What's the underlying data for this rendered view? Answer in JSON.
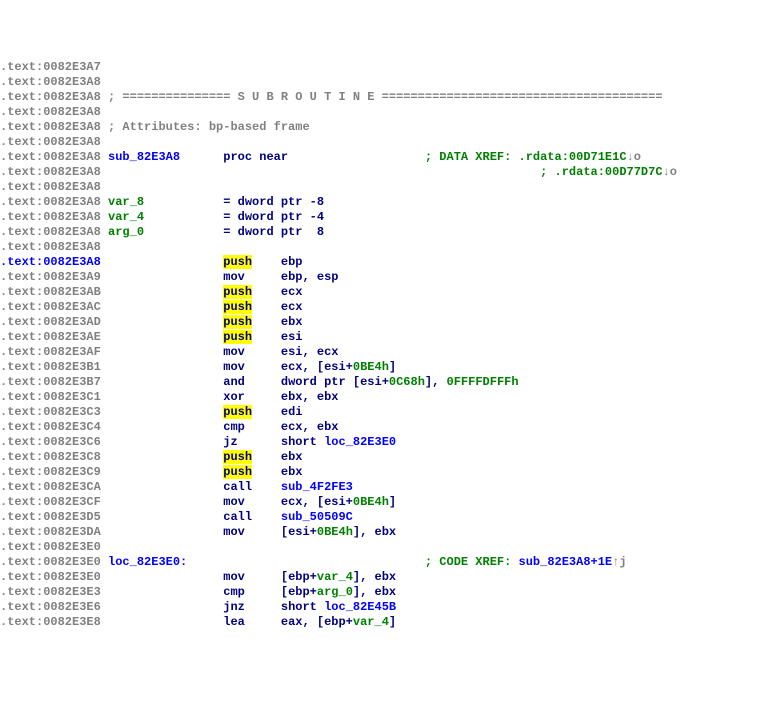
{
  "lines": [
    {
      "addr": ".text:0082E3A7"
    },
    {
      "addr": ".text:0082E3A8"
    },
    {
      "addr": ".text:0082E3A8",
      "cmt_sep": "; =============== S U B R O U T I N E ======================================="
    },
    {
      "addr": ".text:0082E3A8"
    },
    {
      "addr": ".text:0082E3A8",
      "cmt": "; Attributes: bp-based frame"
    },
    {
      "addr": ".text:0082E3A8"
    },
    {
      "addr": ".text:0082E3A8",
      "label": "sub_82E3A8",
      "proc": "proc near",
      "xref_cmt": "; DATA XREF: .rdata:00D71E1C",
      "xref_suffix": "↓o"
    },
    {
      "addr": ".text:0082E3A8",
      "xref_cmt": "; .rdata:00D77D7C",
      "xref_suffix": "↓o"
    },
    {
      "addr": ".text:0082E3A8"
    },
    {
      "addr": ".text:0082E3A8",
      "var": "var_8",
      "vardef": "= dword ptr -8"
    },
    {
      "addr": ".text:0082E3A8",
      "var": "var_4",
      "vardef": "= dword ptr -4"
    },
    {
      "addr": ".text:0082E3A8",
      "var": "arg_0",
      "vardef": "= dword ptr  8"
    },
    {
      "addr": ".text:0082E3A8"
    },
    {
      "addr": ".text:0082E3A8",
      "current": true,
      "hl": true,
      "op": "push",
      "reg": "ebp"
    },
    {
      "addr": ".text:0082E3A9",
      "op": "mov",
      "asm": "ebp, esp"
    },
    {
      "addr": ".text:0082E3AB",
      "hl": true,
      "op": "push",
      "reg": "ecx"
    },
    {
      "addr": ".text:0082E3AC",
      "hl": true,
      "op": "push",
      "reg": "ecx"
    },
    {
      "addr": ".text:0082E3AD",
      "hl": true,
      "op": "push",
      "reg": "ebx"
    },
    {
      "addr": ".text:0082E3AE",
      "hl": true,
      "op": "push",
      "reg": "esi"
    },
    {
      "addr": ".text:0082E3AF",
      "op": "mov",
      "asm": "esi, ecx"
    },
    {
      "addr": ".text:0082E3B1",
      "op": "mov",
      "asm_parts": [
        {
          "t": "ecx, [esi+",
          "c": "reg"
        },
        {
          "t": "0BE4h",
          "c": "num"
        },
        {
          "t": "]",
          "c": "reg"
        }
      ]
    },
    {
      "addr": ".text:0082E3B7",
      "op": "and",
      "asm_parts": [
        {
          "t": "dword ptr [esi+",
          "c": "reg"
        },
        {
          "t": "0C68h",
          "c": "num"
        },
        {
          "t": "], ",
          "c": "reg"
        },
        {
          "t": "0FFFFDFFFh",
          "c": "num"
        }
      ]
    },
    {
      "addr": ".text:0082E3C1",
      "op": "xor",
      "asm": "ebx, ebx"
    },
    {
      "addr": ".text:0082E3C3",
      "hl": true,
      "op": "push",
      "reg": "edi"
    },
    {
      "addr": ".text:0082E3C4",
      "op": "cmp",
      "asm": "ecx, ebx"
    },
    {
      "addr": ".text:0082E3C6",
      "op": "jz",
      "asm_parts": [
        {
          "t": "short ",
          "c": "reg"
        },
        {
          "t": "loc_82E3E0",
          "c": "label"
        }
      ]
    },
    {
      "addr": ".text:0082E3C8",
      "hl": true,
      "op": "push",
      "reg": "ebx"
    },
    {
      "addr": ".text:0082E3C9",
      "hl": true,
      "op": "push",
      "reg": "ebx"
    },
    {
      "addr": ".text:0082E3CA",
      "op": "call",
      "asm_parts": [
        {
          "t": "sub_4F2FE3",
          "c": "label"
        }
      ]
    },
    {
      "addr": ".text:0082E3CF",
      "op": "mov",
      "asm_parts": [
        {
          "t": "ecx, [esi+",
          "c": "reg"
        },
        {
          "t": "0BE4h",
          "c": "num"
        },
        {
          "t": "]",
          "c": "reg"
        }
      ]
    },
    {
      "addr": ".text:0082E3D5",
      "op": "call",
      "asm_parts": [
        {
          "t": "sub_50509C",
          "c": "label"
        }
      ]
    },
    {
      "addr": ".text:0082E3DA",
      "op": "mov",
      "asm_parts": [
        {
          "t": "[esi+",
          "c": "reg"
        },
        {
          "t": "0BE4h",
          "c": "num"
        },
        {
          "t": "], ebx",
          "c": "reg"
        }
      ]
    },
    {
      "addr": ".text:0082E3E0"
    },
    {
      "addr": ".text:0082E3E0",
      "loclabel": "loc_82E3E0:",
      "xref_cmt": "; CODE XREF: ",
      "xref_link": "sub_82E3A8+1E",
      "xref_suffix": "↑j"
    },
    {
      "addr": ".text:0082E3E0",
      "op": "mov",
      "asm_parts": [
        {
          "t": "[ebp+",
          "c": "reg"
        },
        {
          "t": "var_4",
          "c": "var"
        },
        {
          "t": "], ebx",
          "c": "reg"
        }
      ]
    },
    {
      "addr": ".text:0082E3E3",
      "op": "cmp",
      "asm_parts": [
        {
          "t": "[ebp+",
          "c": "reg"
        },
        {
          "t": "arg_0",
          "c": "var"
        },
        {
          "t": "], ebx",
          "c": "reg"
        }
      ]
    },
    {
      "addr": ".text:0082E3E6",
      "op": "jnz",
      "asm_parts": [
        {
          "t": "short ",
          "c": "reg"
        },
        {
          "t": "loc_82E45B",
          "c": "label"
        }
      ]
    },
    {
      "addr": ".text:0082E3E8",
      "op": "lea",
      "asm_parts": [
        {
          "t": "eax, [ebp+",
          "c": "reg"
        },
        {
          "t": "var_4",
          "c": "var"
        },
        {
          "t": "]",
          "c": "reg"
        }
      ]
    }
  ],
  "cols": {
    "label": 16,
    "op": 32,
    "args": 40,
    "cmt": 60
  }
}
